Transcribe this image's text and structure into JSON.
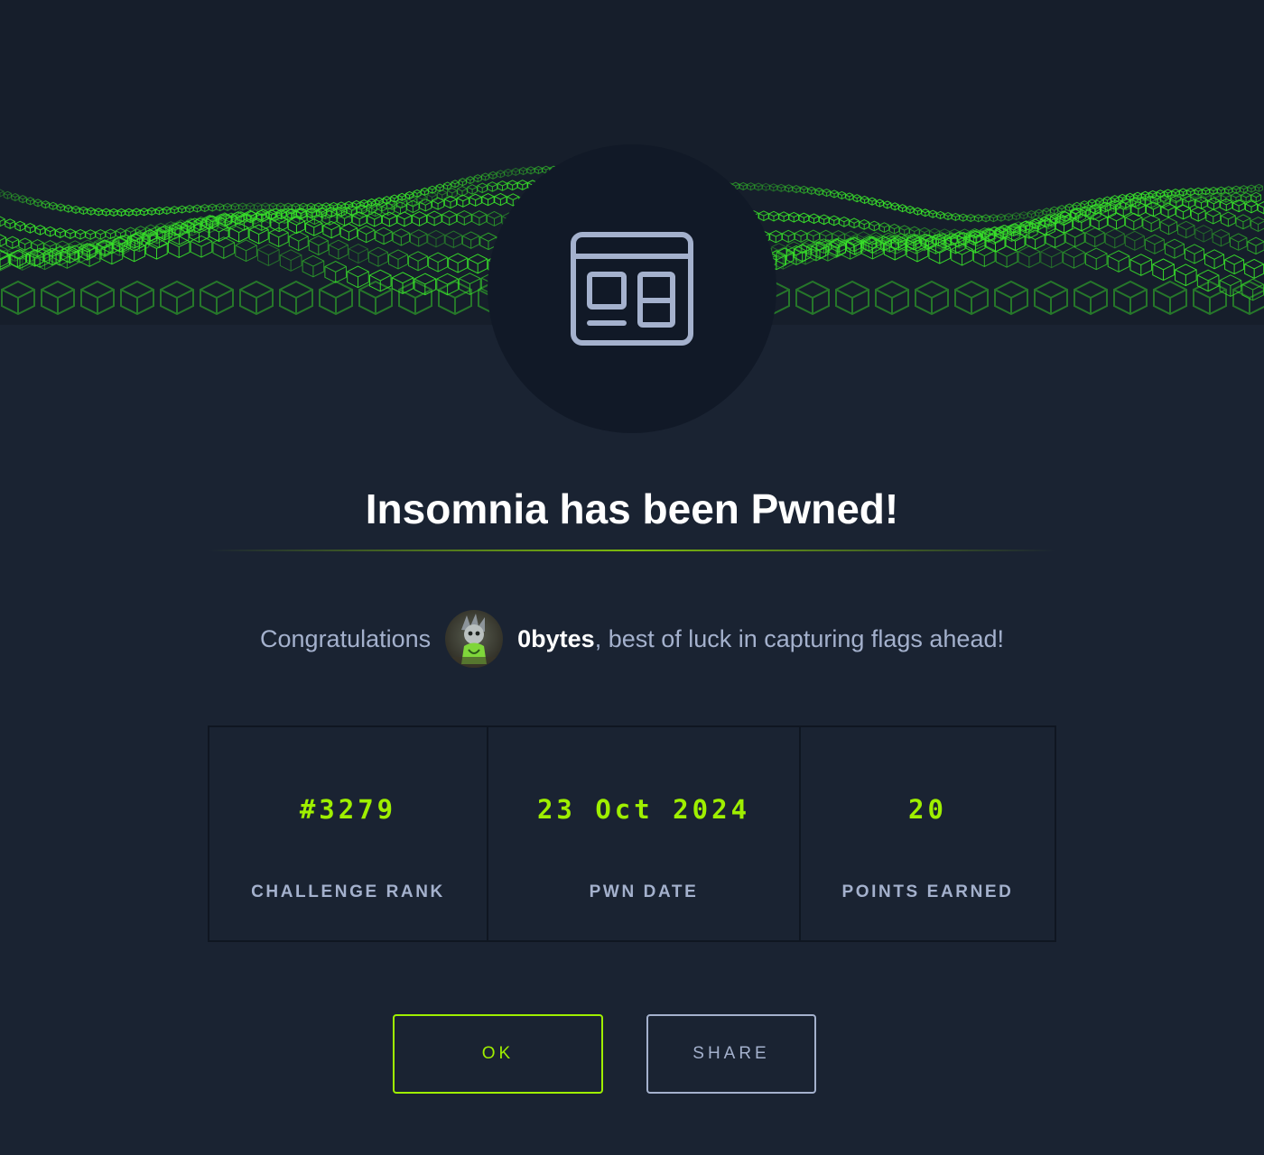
{
  "title": "Insomnia has been Pwned!",
  "congrats": {
    "prefix": "Congratulations",
    "username": "0bytes",
    "suffix": ", best of luck in capturing flags ahead!"
  },
  "stats": [
    {
      "value": "#3279",
      "label": "CHALLENGE RANK"
    },
    {
      "value": "23 Oct 2024",
      "label": "PWN DATE"
    },
    {
      "value": "20",
      "label": "POINTS EARNED"
    }
  ],
  "buttons": {
    "ok": "OK",
    "share": "SHARE"
  },
  "icons": {
    "challenge": "web-layout-icon",
    "avatar": "user-avatar"
  },
  "colors": {
    "accent": "#9fef00",
    "muted_text": "#a4b1cd",
    "background": "#1a2332",
    "circle": "#111927"
  }
}
